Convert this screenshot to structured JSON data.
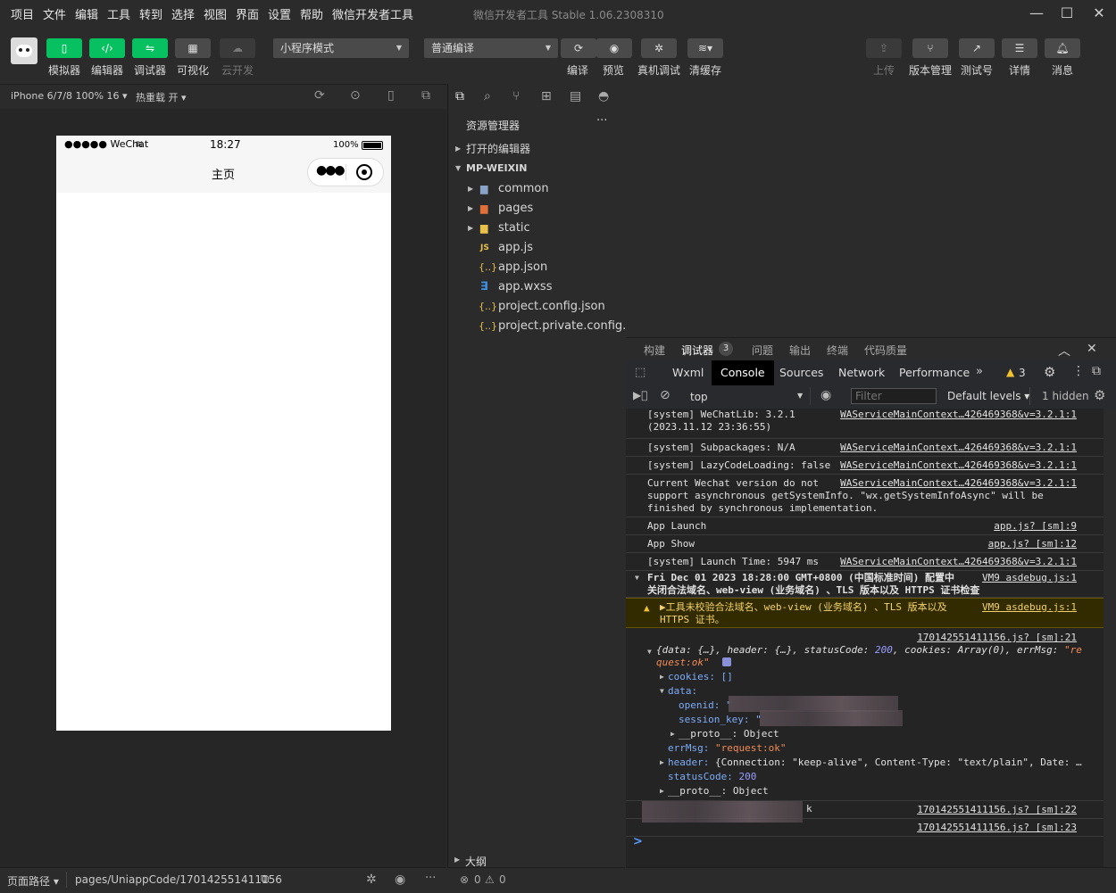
{
  "menu": [
    "项目",
    "文件",
    "编辑",
    "工具",
    "转到",
    "选择",
    "视图",
    "界面",
    "设置",
    "帮助",
    "微信开发者工具"
  ],
  "window_title": "微信开发者工具 Stable 1.06.2308310",
  "toolbar": {
    "simulator": "模拟器",
    "editor": "编辑器",
    "debugger": "调试器",
    "visual": "可视化",
    "cloud": "云开发",
    "mode_select": "小程序模式",
    "compile_select": "普通编译",
    "compile": "编译",
    "preview": "预览",
    "real_debug": "真机调试",
    "clear_cache": "清缓存",
    "upload": "上传",
    "version": "版本管理",
    "test_account": "测试号",
    "details": "详情",
    "messages": "消息"
  },
  "sim": {
    "device": "iPhone 6/7/8 100% 16",
    "hot_reload": "热重载 开",
    "carrier": "●●●●● WeChat",
    "time": "18:27",
    "battery": "100%",
    "nav_title": "主页"
  },
  "explorer": {
    "title": "资源管理器",
    "more": "···",
    "open_editors": "打开的编辑器",
    "project": "MP-WEIXIN",
    "items": [
      {
        "label": "common",
        "type": "folder"
      },
      {
        "label": "pages",
        "type": "folder"
      },
      {
        "label": "static",
        "type": "folder"
      },
      {
        "label": "app.js",
        "type": "js"
      },
      {
        "label": "app.json",
        "type": "json"
      },
      {
        "label": "app.wxss",
        "type": "wxss"
      },
      {
        "label": "project.config.json",
        "type": "json"
      },
      {
        "label": "project.private.config.js...",
        "type": "json"
      }
    ],
    "outline": "大纲"
  },
  "devtools": {
    "tabs": [
      "构建",
      "调试器",
      "问题",
      "输出",
      "终端",
      "代码质量"
    ],
    "badge": "3",
    "panels": [
      "Wxml",
      "Console",
      "Sources",
      "Network",
      "Performance"
    ],
    "warn_count": "3",
    "context": "top",
    "filter_placeholder": "Filter",
    "levels": "Default levels",
    "hidden": "1 hidden"
  },
  "console": {
    "logs": [
      {
        "msg": "[system] WeChatLib: 3.2.1\n(2023.11.12 23:36:55)",
        "src": "WAServiceMainContext…426469368&v=3.2.1:1"
      },
      {
        "msg": "[system] Subpackages: N/A",
        "src": "WAServiceMainContext…426469368&v=3.2.1:1"
      },
      {
        "msg": "[system] LazyCodeLoading: false",
        "src": "WAServiceMainContext…426469368&v=3.2.1:1"
      },
      {
        "msg": "Current Wechat version do not\nsupport asynchronous getSystemInfo. \"wx.getSystemInfoAsync\" will be\nfinished by synchronous implementation.",
        "src": "WAServiceMainContext…426469368&v=3.2.1:1"
      },
      {
        "msg": "App Launch",
        "src": "app.js? [sm]:9"
      },
      {
        "msg": "App Show",
        "src": "app.js? [sm]:12"
      },
      {
        "msg": "[system] Launch Time: 5947 ms",
        "src": "WAServiceMainContext…426469368&v=3.2.1:1"
      },
      {
        "msg": "Fri Dec 01 2023 18:28:00 GMT+0800 (中国标准时间) 配置中\n关闭合法域名、web-view (业务域名) 、TLS 版本以及 HTTPS 证书检查",
        "src": "VM9 asdebug.js:1"
      },
      {
        "msg": "▶工具未校验合法域名、web-view (业务域名) 、TLS 版本以及\nHTTPS 证书。",
        "src": "VM9 asdebug.js:1"
      }
    ],
    "obj_src": "170142551411156.js? [sm]:21",
    "obj_summary_1": "{data: {…}, header: {…}, statusCode: ",
    "obj_summary_status": "200",
    "obj_summary_2": ", cookies: Array(0), errMsg: ",
    "obj_summary_err1": "\"re",
    "obj_summary_err2": "quest:ok\"",
    "cookies": "cookies: []",
    "data": "data:",
    "openid": "openid: \"",
    "session_key": "session_key: \"",
    "proto1": "__proto__: Object",
    "errmsg_key": "errMsg: ",
    "errmsg_val": "\"request:ok\"",
    "header_key": "header: ",
    "header_val": "{Connection: \"keep-alive\", Content-Type: \"text/plain\", Date: …",
    "status_key": "statusCode: ",
    "status_val": "200",
    "proto2": "__proto__: Object",
    "line22_src": "170142551411156.js? [sm]:22",
    "line22_tail": "k",
    "line23_src": "170142551411156.js? [sm]:23",
    "prompt": ">"
  },
  "footer": {
    "path_label": "页面路径",
    "path": "pages/UniappCode/170142551411156",
    "errors": "0",
    "warnings": "0"
  }
}
